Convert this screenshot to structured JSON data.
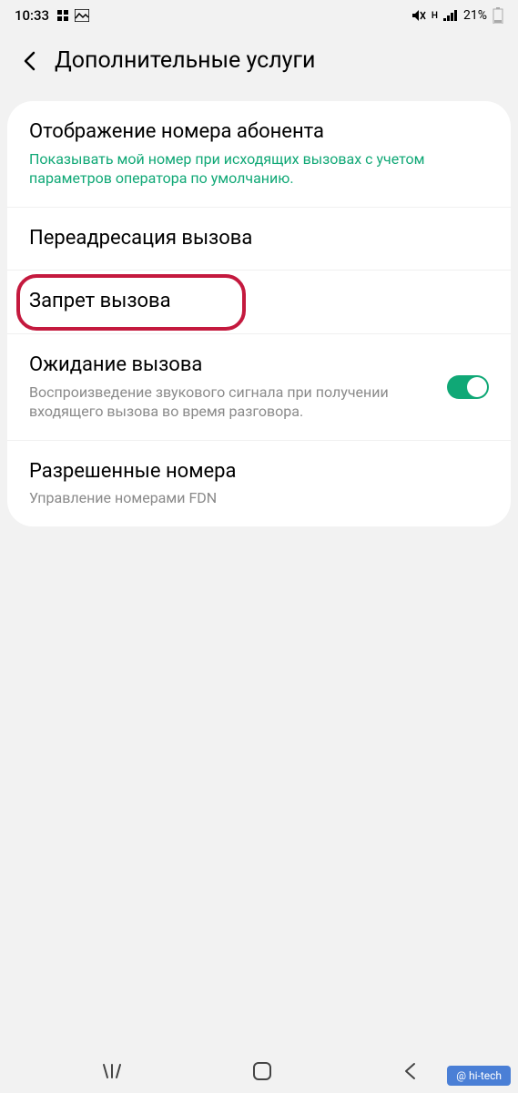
{
  "statusBar": {
    "time": "10:33",
    "batteryPercent": "21%"
  },
  "header": {
    "title": "Дополнительные услуги"
  },
  "items": [
    {
      "title": "Отображение номера абонента",
      "subtitle": "Показывать мой номер при исходящих вызовах с учетом параметров оператора по умолчанию."
    },
    {
      "title": "Переадресация вызова"
    },
    {
      "title": "Запрет вызова"
    },
    {
      "title": "Ожидание вызова",
      "subtitle": "Воспроизведение звукового сигнала при получении входящего вызова во время разговора."
    },
    {
      "title": "Разрешенные номера",
      "subtitle": "Управление номерами FDN"
    }
  ],
  "watermark": "@ hi-tech"
}
